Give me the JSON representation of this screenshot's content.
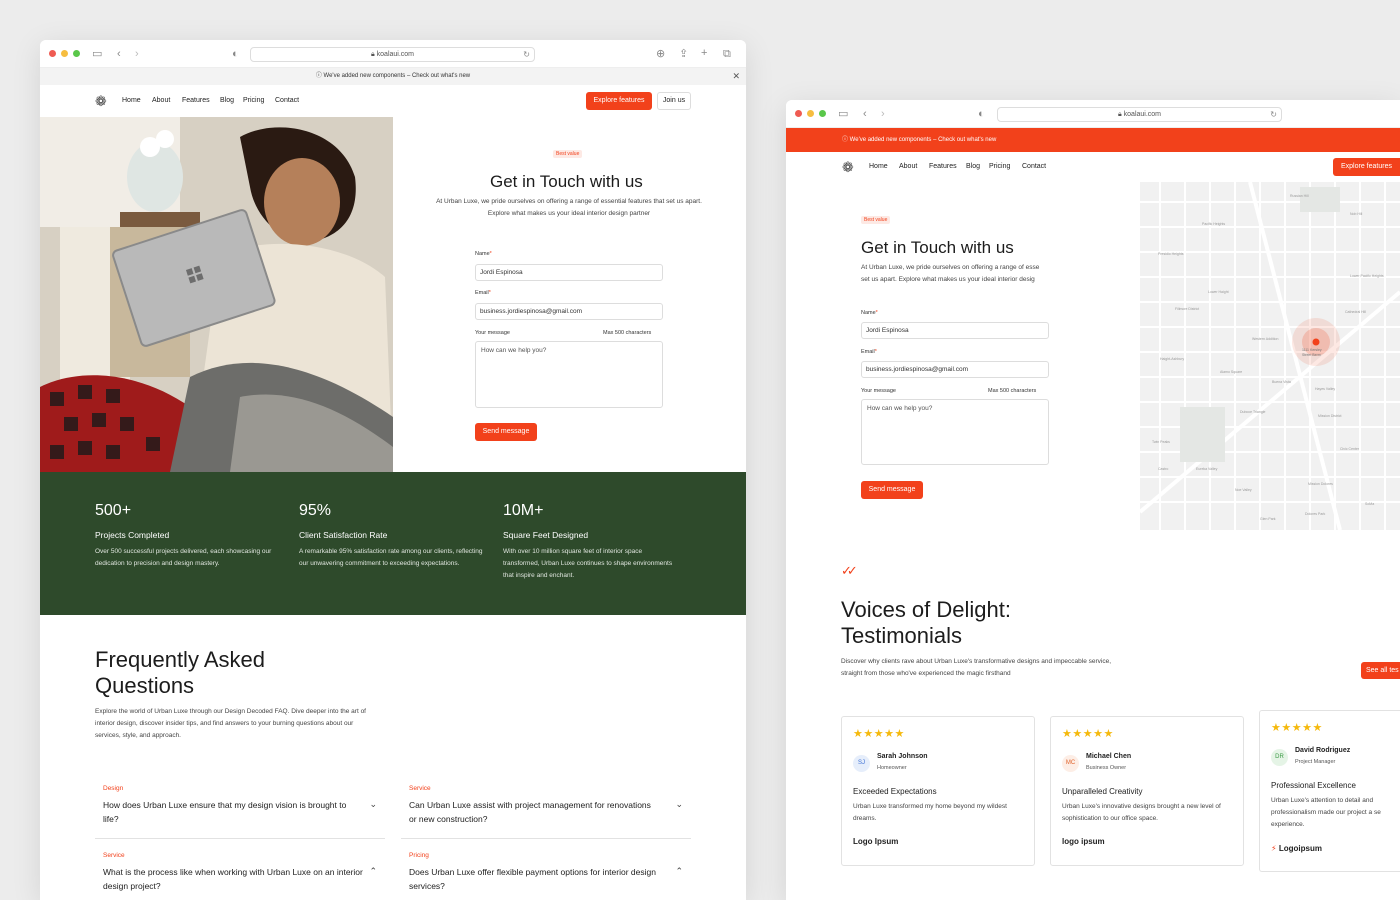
{
  "browser": {
    "url": "koalaui.com"
  },
  "banner": {
    "text": "We've added new components – Check out what's new",
    "close_icon": "close-icon"
  },
  "nav": {
    "links": [
      "Home",
      "About",
      "Features",
      "Blog",
      "Pricing",
      "Contact"
    ],
    "explore_label": "Explore features",
    "join_label": "Join us"
  },
  "contact": {
    "badge": "Best value",
    "title": "Get in Touch with us",
    "lead": "At Urban Luxe, we pride ourselves on offering a range of essential features that set us apart. Explore what makes us your ideal interior design partner",
    "lead_cut": "At Urban Luxe, we pride ourselves on offering a range of esse",
    "lead_cut2": "set us apart. Explore what makes us your ideal interior desig",
    "name_label": "Name",
    "name_value": "Jordi Espinosa",
    "email_label": "Email",
    "email_value": "business.jordiespinosa@gmail.com",
    "message_label": "Your message",
    "message_hint": "Max 500 characters",
    "message_placeholder": "How can we help you?",
    "send_label": "Send message",
    "required_mark": "*"
  },
  "stats": [
    {
      "num": "500+",
      "label": "Projects Completed",
      "desc": "Over 500 successful projects delivered, each showcasing our dedication to precision and design mastery."
    },
    {
      "num": "95%",
      "label": "Client Satisfaction Rate",
      "desc": "A remarkable 95% satisfaction rate among our clients, reflecting our unwavering commitment to exceeding expectations."
    },
    {
      "num": "10M+",
      "label": "Square Feet Designed",
      "desc": "With over 10 million square feet of interior space transformed, Urban Luxe continues to shape environments that inspire and enchant."
    }
  ],
  "faq": {
    "title": "Frequently Asked Questions",
    "intro": "Explore the world of Urban Luxe through our Design Decoded FAQ. Dive deeper into the art of interior design, discover insider tips, and find answers to your burning questions about our services, style, and approach.",
    "items": [
      {
        "cat": "Design",
        "q": "How does Urban Luxe ensure that my design vision is brought to life?"
      },
      {
        "cat": "Service",
        "q": "Can Urban Luxe assist with project management for renovations or new construction?"
      },
      {
        "cat": "Service",
        "q": "What is the process like when working with Urban Luxe on an interior design project?"
      },
      {
        "cat": "Pricing",
        "q": "Does Urban Luxe offer flexible payment options for interior design services?"
      }
    ]
  },
  "testimonials": {
    "title": "Voices of Delight: Testimonials",
    "intro": "Discover why clients rave about Urban Luxe's transformative designs and impeccable service, straight from those who've experienced the magic firsthand",
    "see_all": "See all tes",
    "stars": "★★★★★",
    "cards": [
      {
        "initials": "SJ",
        "name": "Sarah Johnson",
        "role": "Homeowner",
        "title": "Exceeded Expectations",
        "text": "Urban Luxe transformed my home beyond my wildest dreams.",
        "brand": "Logo  Ipsum"
      },
      {
        "initials": "MC",
        "name": "Michael Chen",
        "role": "Business Owner",
        "title": "Unparalleled Creativity",
        "text": "Urban Luxe's innovative designs brought a new level of sophistication to our office space.",
        "brand": "logo  ipsum"
      },
      {
        "initials": "DR",
        "name": "David Rodriguez",
        "role": "Project Manager",
        "title": "Professional Excellence",
        "text": "Urban Luxe's attention to detail and professionalism made our project a se experience.",
        "brand": "Logoipsum"
      }
    ]
  },
  "map": {
    "labels": [
      "Russian Hill",
      "Nob Hill",
      "Western Addition",
      "Haight-Ashbury",
      "Mission Dolores",
      "Noe Valley",
      "Lower Haight",
      "Duboce Triangle",
      "Eureka Valley",
      "Castro",
      "Pacific Heights",
      "Lower Pacific Heights",
      "Fillmore District",
      "Hayes Valley",
      "Civic Center",
      "SoMa",
      "Dolores Park",
      "Twin Peaks",
      "Glen Park",
      "Mission District",
      "Presidio Heights",
      "Cathedral Hill",
      "Alamo Square",
      "Buena Vista"
    ],
    "pin_label": "1111 Kersley Street Berm",
    "colors": {
      "bg": "#f1f1f1",
      "roads": "#ffffff",
      "park": "#e4e9e3",
      "pin": "#f2411b"
    }
  },
  "colors": {
    "accent": "#f2411b",
    "stats_bg": "#2e4a2b",
    "star": "#f5b90c"
  }
}
